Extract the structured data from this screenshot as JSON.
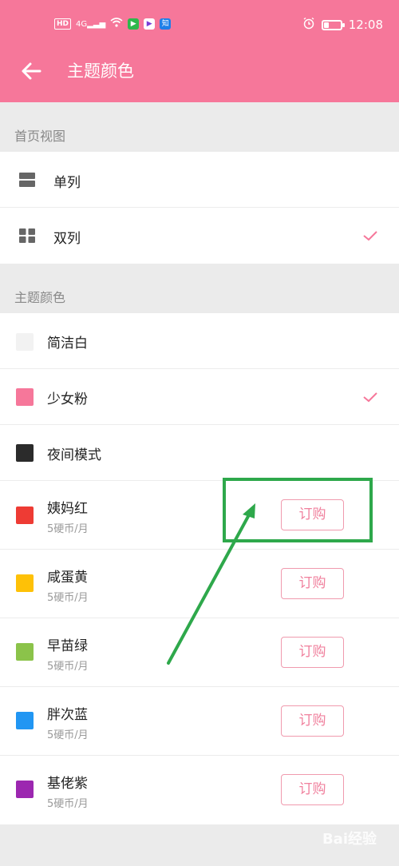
{
  "statusbar": {
    "left_icons": [
      "HD",
      "4G",
      "signal",
      "wifi",
      "app-green",
      "app-purple",
      "知"
    ],
    "time": "12:08",
    "battery_level": 0.3
  },
  "appbar": {
    "title": "主题颜色"
  },
  "sections": {
    "view": {
      "header": "首页视图",
      "items": [
        {
          "label": "单列",
          "icon": "single-column-icon",
          "selected": false
        },
        {
          "label": "双列",
          "icon": "double-column-icon",
          "selected": true
        }
      ]
    },
    "color": {
      "header": "主题颜色",
      "items": [
        {
          "label": "简洁白",
          "color": "#f2f2f2",
          "selected": false
        },
        {
          "label": "少女粉",
          "color": "#f6779a",
          "selected": true
        },
        {
          "label": "夜间模式",
          "color": "#2b2b2b",
          "selected": false
        },
        {
          "label": "姨妈红",
          "sub": "5硬币/月",
          "color": "#ee3b34",
          "button": "订购"
        },
        {
          "label": "咸蛋黄",
          "sub": "5硬币/月",
          "color": "#fec107",
          "button": "订购"
        },
        {
          "label": "早苗绿",
          "sub": "5硬币/月",
          "color": "#8bc34a",
          "button": "订购"
        },
        {
          "label": "胖次蓝",
          "sub": "5硬币/月",
          "color": "#2196f3",
          "button": "订购"
        },
        {
          "label": "基佬紫",
          "sub": "5硬币/月",
          "color": "#9c27b0",
          "button": "订购"
        }
      ]
    }
  },
  "watermark": "Bai经验",
  "colors": {
    "accent": "#f6779a",
    "annotation": "#2ea84b"
  }
}
